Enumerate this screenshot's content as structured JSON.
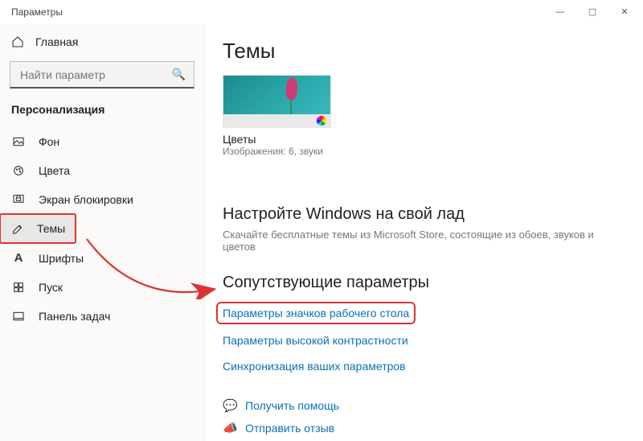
{
  "window": {
    "title": "Параметры"
  },
  "sidebar": {
    "home_label": "Главная",
    "search_placeholder": "Найти параметр",
    "section_label": "Персонализация",
    "items": [
      {
        "label": "Фон"
      },
      {
        "label": "Цвета"
      },
      {
        "label": "Экран блокировки"
      },
      {
        "label": "Темы"
      },
      {
        "label": "Шрифты"
      },
      {
        "label": "Пуск"
      },
      {
        "label": "Панель задач"
      }
    ]
  },
  "main": {
    "title": "Темы",
    "theme": {
      "name": "Цветы",
      "subtitle": "Изображения: 6, звуки"
    },
    "section_heading": "Настройте Windows на свой лад",
    "section_desc": "Скачайте бесплатные темы из Microsoft Store, состоящие из обоев, звуков и цветов",
    "related_heading": "Сопутствующие параметры",
    "links": {
      "desktop_icons": "Параметры значков рабочего стола",
      "high_contrast": "Параметры высокой контрастности",
      "sync": "Синхронизация ваших параметров"
    },
    "help": {
      "get_help": "Получить помощь",
      "feedback": "Отправить отзыв"
    }
  }
}
